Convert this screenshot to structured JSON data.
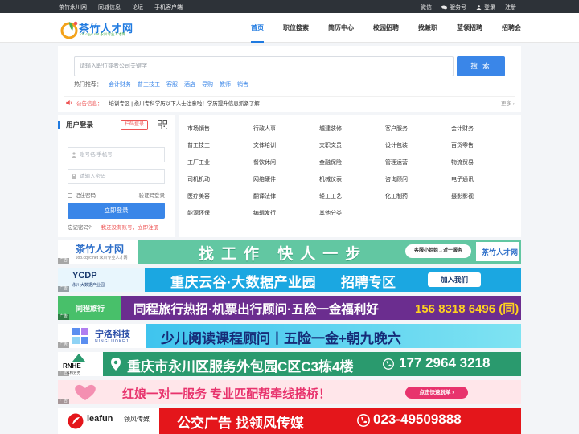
{
  "topbar": {
    "left_links": [
      "茶竹永川网",
      "同城信息",
      "论坛",
      "手机客户端"
    ],
    "right": {
      "wechat": "微信",
      "service": "服务号",
      "login": "登录",
      "register": "注册"
    }
  },
  "header": {
    "logo_text": "茶竹人才网",
    "logo_sub": "Job.cqyc.net 永川专业人才网",
    "nav": [
      "首页",
      "职位搜索",
      "简历中心",
      "校园招聘",
      "找兼职",
      "蓝领招聘",
      "招聘会"
    ],
    "active_nav": "首页"
  },
  "search": {
    "placeholder": "请输入职位或者公司关键字",
    "button": "搜 索",
    "hot_label": "热门推荐：",
    "hot_items": [
      "会计财务",
      "普工技工",
      "客服",
      "酒店",
      "导购",
      "教师",
      "销售"
    ]
  },
  "notice": {
    "label": "公告信息：",
    "text": "培训专区 | 永川专科学历以下人士注意啦！学历提升信息抓紧了解",
    "more": "更多 ›"
  },
  "login": {
    "title": "用户登录",
    "sms_button": "扫码登录",
    "username_placeholder": "账号名/手机号",
    "password_placeholder": "请输入密码",
    "remember": "记住密码",
    "captcha_login": "验证码登录",
    "submit": "立即登录",
    "forgot": "忘记密码?",
    "register": "我还没有账号，立即注册"
  },
  "categories": [
    "市场销售",
    "行政人事",
    "城建装修",
    "客户服务",
    "会计财务",
    "普工技工",
    "文体培训",
    "文职文员",
    "设计包装",
    "百货零售",
    "工厂工业",
    "餐饮休闲",
    "金融保险",
    "管理运营",
    "物流贸易",
    "司机机动",
    "网络硬件",
    "机械仪表",
    "咨询顾问",
    "电子通讯",
    "医疗美容",
    "翻译法律",
    "轻工工艺",
    "化工制药",
    "摄影影视",
    "能源环保",
    "编辑发行",
    "其他分类"
  ],
  "banners": {
    "tag": "广告",
    "b1": {
      "logo": "茶竹人才网",
      "logo_sub": "Job.cqyc.net 永川专业人才网",
      "main": "找工作 快人一步",
      "pill": "客服小姐姐→对一服务",
      "bot": "茶竹人才网"
    },
    "b2": {
      "logo": "YCDP",
      "logo_sub": "永川大数据产业园",
      "main": "重庆云谷·大数据产业园",
      "main2": "招聘专区",
      "button": "加入我们"
    },
    "b3": {
      "logo": "同程旅行",
      "main": "同程旅行热招·机票出行顾问·五险一金福利好",
      "tel": "156 8318 6496 (同)"
    },
    "b4": {
      "logo": "宁洛科技",
      "logo_sub": "NINGLUOKEJI",
      "main": "少儿阅读课程顾问丨五险一金+朝九晚六"
    },
    "b5": {
      "logo": "RNHE",
      "logo_sub": "人和劳务",
      "main": "重庆市永川区服务外包园C区C3栋4楼",
      "tel": "177 2964 3218"
    },
    "b6": {
      "main": "红娘一对一服务 专业匹配帮牵线搭桥！",
      "button": "点击快速脱单 ›"
    },
    "b7": {
      "logo": "leafun",
      "logo_sub": "领风传媒",
      "main": "公交广告  找领风传媒",
      "tel": "023-49509888"
    }
  },
  "colors": {
    "brand": "#1f7ae0",
    "accent": "#e55555",
    "topbar": "#2d3238"
  }
}
